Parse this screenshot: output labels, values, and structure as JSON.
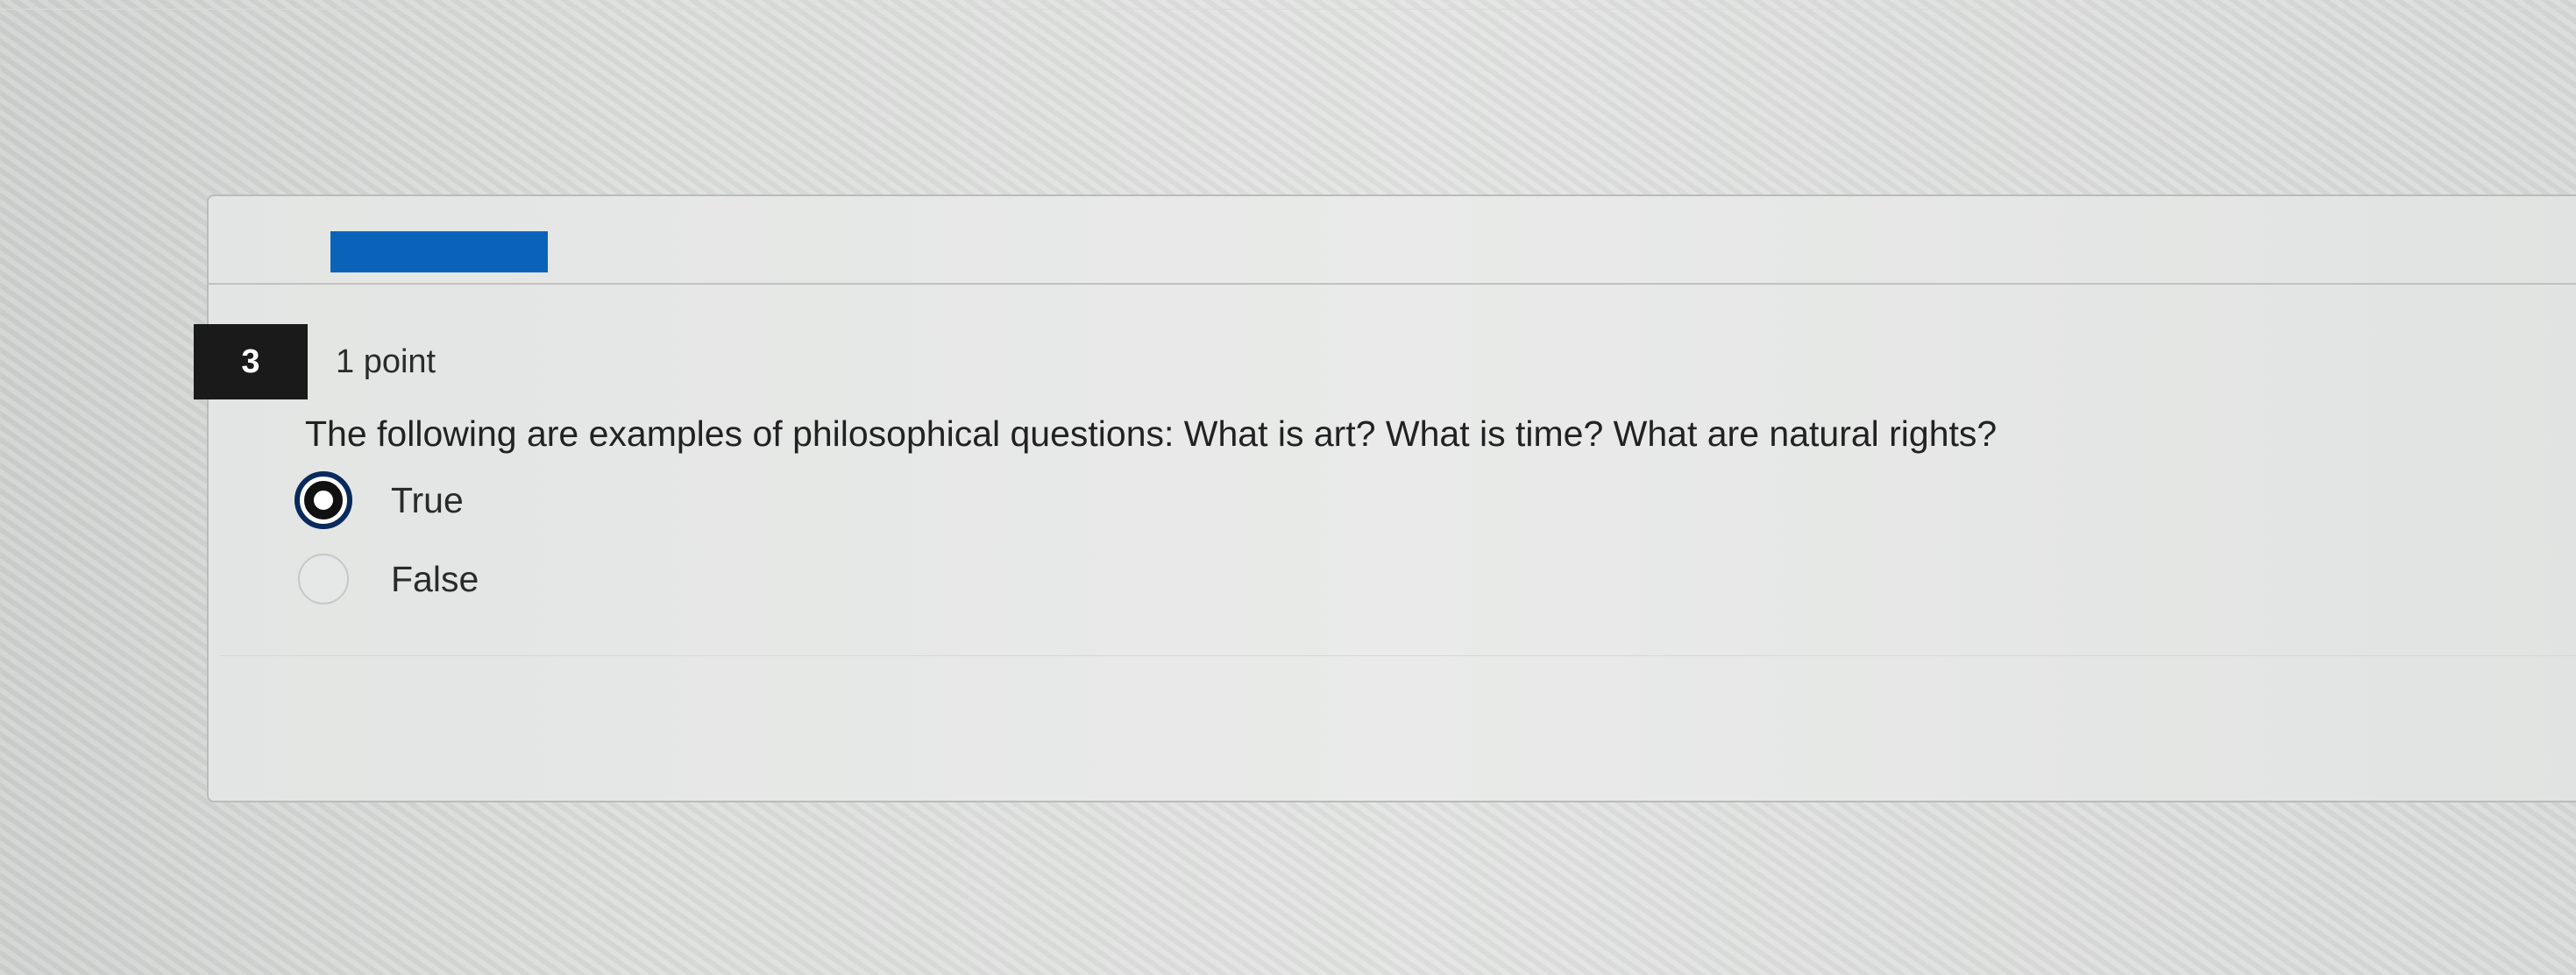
{
  "question": {
    "number": "3",
    "points": "1 point",
    "text": "The following are examples of philosophical questions: What is art? What is time? What are natural rights?",
    "options": [
      {
        "label": "True",
        "selected": true
      },
      {
        "label": "False",
        "selected": false
      }
    ]
  },
  "colors": {
    "accent": "#0a63b8",
    "number_badge": "#1a1a1a"
  }
}
